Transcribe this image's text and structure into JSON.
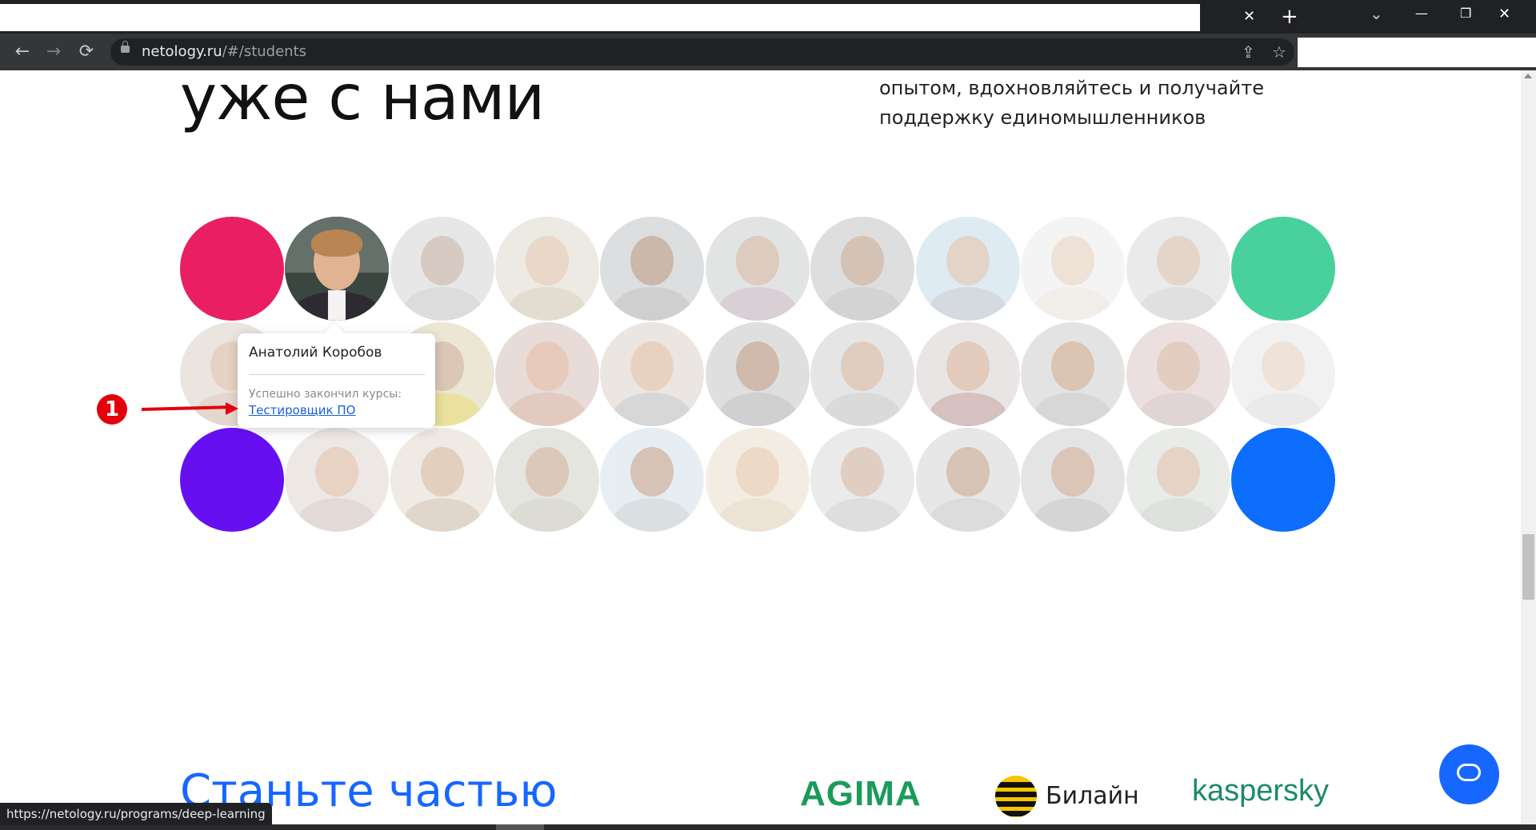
{
  "browser": {
    "tab_close": "✕",
    "new_tab": "+",
    "tab_search": "⌄",
    "minimize": "—",
    "restore": "❐",
    "close": "✕",
    "url_host": "netology.ru",
    "url_path": "/#/students",
    "back": "←",
    "forward": "→",
    "reload": "⟳",
    "share": "⇪",
    "bookmark": "☆"
  },
  "hero": {
    "title": "уже с нами",
    "description_line1": "опытом, вдохновляйтесь и получайте",
    "description_line2": "поддержку единомышленников"
  },
  "grid": {
    "rows": 3,
    "cols": 11,
    "accent_colors": {
      "pink": "#e91e63",
      "green": "#48d19c",
      "purple": "#6610f2",
      "blue": "#0d6efd"
    }
  },
  "tooltip": {
    "name": "Анатолий Коробов",
    "label": "Успешно закончил курсы:",
    "course": "Тестировщик ПО"
  },
  "annotation": {
    "marker": "1"
  },
  "bottom": {
    "heading": "Станьте частью",
    "partners": [
      "AGIMA",
      "Билайн",
      "kaspersky"
    ]
  },
  "status_bar": {
    "url": "https://netology.ru/programs/deep-learning"
  }
}
